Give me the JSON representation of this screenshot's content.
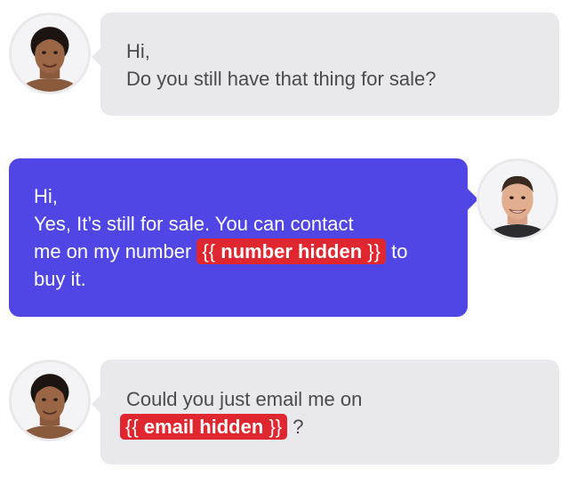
{
  "conversation": {
    "colors": {
      "incoming_bubble": "#e9e9ed",
      "outgoing_bubble": "#5046e5",
      "redaction": "#e0262e"
    },
    "messages": [
      {
        "sender": "buyer",
        "direction": "incoming",
        "avatar_icon": "woman-avatar-icon",
        "lines": [
          "Hi,",
          "Do you still have that thing for sale?"
        ]
      },
      {
        "sender": "seller",
        "direction": "outgoing",
        "avatar_icon": "man-avatar-icon",
        "lines": [
          "Hi,",
          "Yes, It’s still for sale. You can contact",
          "me on my number",
          "to",
          "buy it."
        ],
        "redaction": {
          "open": "{{",
          "label": "number hidden",
          "close": "}}"
        }
      },
      {
        "sender": "buyer",
        "direction": "incoming",
        "avatar_icon": "woman-avatar-icon",
        "lines": [
          "Could you just email me on",
          "?"
        ],
        "redaction": {
          "open": "{{",
          "label": "email hidden",
          "close": "}}"
        }
      }
    ]
  }
}
